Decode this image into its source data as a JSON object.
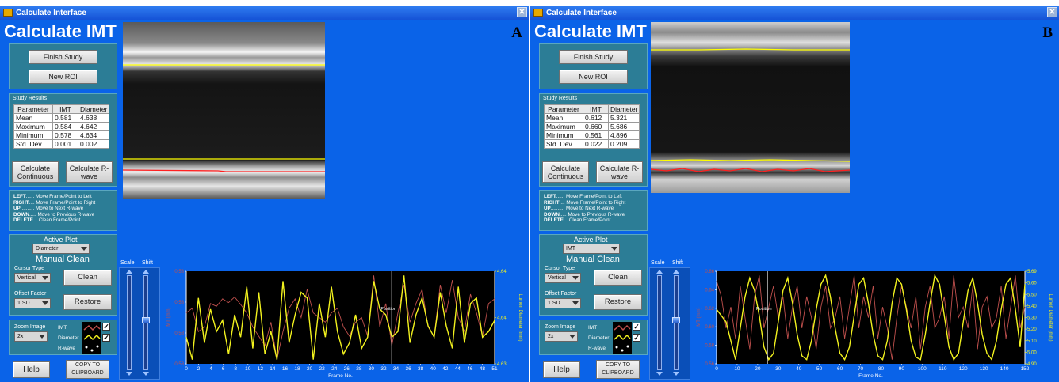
{
  "panels": [
    {
      "window_title": "Calculate Interface",
      "app_title": "Calculate IMT",
      "panel_letter": "A",
      "buttons": {
        "finish_study": "Finish Study",
        "new_roi": "New ROI",
        "calc_continuous": "Calculate Continuous",
        "calc_rwave": "Calculate R-wave",
        "clean": "Clean",
        "restore": "Restore",
        "help": "Help",
        "copy_clipboard": "COPY TO CLIPBOARD"
      },
      "study_results": {
        "label": "Study Results",
        "headers": [
          "Parameter",
          "IMT",
          "Diameter"
        ],
        "rows": [
          [
            "Mean",
            "0.581",
            "4.638"
          ],
          [
            "Maximum",
            "0.584",
            "4.642"
          ],
          [
            "Minimum",
            "0.578",
            "4.634"
          ],
          [
            "Std. Dev.",
            "0.001",
            "0.002"
          ]
        ]
      },
      "shortcuts": [
        {
          "key": "LEFT",
          "dots": "......",
          "desc": "Move Frame/Point to Left"
        },
        {
          "key": "RIGHT",
          "dots": "....",
          "desc": "Move Frame/Point to Right"
        },
        {
          "key": "UP",
          "dots": "..........",
          "desc": "Move to Next R-wave"
        },
        {
          "key": "DOWN",
          "dots": ".....",
          "desc": "Move to Previous R-wave"
        },
        {
          "key": "DELETE",
          "dots": "...",
          "desc": "Clean Frame/Point"
        }
      ],
      "active_plot": {
        "label": "Active Plot",
        "value": "Diameter"
      },
      "manual_clean": "Manual Clean",
      "cursor_type": {
        "label": "Cursor Type",
        "value": "Vertical"
      },
      "offset_factor": {
        "label": "Offset Factor",
        "value": "1 SD"
      },
      "zoom_image": {
        "label": "Zoom Image",
        "value": "2x"
      },
      "legend": {
        "imt": "IMT",
        "diameter": "Diameter",
        "rwave": "R-wave"
      },
      "scale_label": "Scale",
      "shift_label": "Shift",
      "chart_data": {
        "type": "line",
        "x_label": "Frame No.",
        "x_ticks": [
          "0",
          "2",
          "4",
          "6",
          "8",
          "10",
          "12",
          "14",
          "16",
          "18",
          "20",
          "22",
          "24",
          "26",
          "28",
          "30",
          "32",
          "34",
          "36",
          "38",
          "40",
          "42",
          "44",
          "46",
          "48",
          "51"
        ],
        "xlim": [
          0,
          51
        ],
        "y_left_label": "IMT (mm)",
        "y_left_ticks": [
          "0.58",
          "0.58",
          "0.58",
          "0.58"
        ],
        "y_right_label": "Lumen Diameter (mm)",
        "y_right_ticks": [
          "4.64",
          "4.64",
          "4.63"
        ],
        "cursor_label": "Position",
        "cursor_x": 34,
        "series": [
          {
            "name": "IMT",
            "color": "#c0504d",
            "values": [
              0.55,
              0.6,
              0.35,
              0.4,
              0.65,
              0.62,
              0.7,
              0.66,
              0.72,
              0.64,
              0.55,
              0.4,
              0.3,
              0.2,
              0.45,
              0.05,
              0.35,
              0.6,
              0.7,
              0.5,
              0.8,
              0.55,
              0.5,
              0.45,
              0.55,
              0.6,
              0.4,
              0.3,
              0.45,
              0.5,
              0.3,
              0.95,
              0.4,
              0.65,
              0.2,
              0.55,
              0.85,
              0.45,
              0.65,
              0.8,
              0.4,
              0.3,
              0.85,
              0.55,
              0.9,
              0.5,
              0.35,
              0.75,
              0.55,
              0.3,
              0.65,
              0.7
            ]
          },
          {
            "name": "Diameter",
            "color": "#f2f21e",
            "values": [
              0.35,
              0.15,
              0.7,
              0.3,
              0.6,
              0.4,
              0.5,
              0.2,
              0.55,
              0.35,
              0.8,
              0.25,
              0.75,
              0.2,
              0.4,
              0.15,
              0.85,
              0.3,
              0.55,
              0.75,
              0.7,
              0.15,
              0.65,
              0.35,
              0.8,
              0.4,
              0.2,
              0.3,
              0.55,
              0.25,
              0.35,
              0.85,
              0.6,
              0.55,
              0.35,
              0.4,
              0.9,
              0.3,
              0.55,
              0.7,
              0.45,
              0.35,
              0.75,
              0.45,
              0.25,
              0.8,
              0.3,
              0.65,
              0.7,
              0.35,
              0.4,
              0.5
            ]
          }
        ]
      }
    },
    {
      "window_title": "Calculate Interface",
      "app_title": "Calculate IMT",
      "panel_letter": "B",
      "buttons": {
        "finish_study": "Finish Study",
        "new_roi": "New ROI",
        "calc_continuous": "Calculate Continuous",
        "calc_rwave": "Calculate R-wave",
        "clean": "Clean",
        "restore": "Restore",
        "help": "Help",
        "copy_clipboard": "COPY TO CLIPBOARD"
      },
      "study_results": {
        "label": "Study Results",
        "headers": [
          "Parameter",
          "IMT",
          "Diameter"
        ],
        "rows": [
          [
            "Mean",
            "0.612",
            "5.321"
          ],
          [
            "Maximum",
            "0.660",
            "5.686"
          ],
          [
            "Minimum",
            "0.561",
            "4.896"
          ],
          [
            "Std. Dev.",
            "0.022",
            "0.209"
          ]
        ]
      },
      "shortcuts": [
        {
          "key": "LEFT",
          "dots": "......",
          "desc": "Move Frame/Point to Left"
        },
        {
          "key": "RIGHT",
          "dots": "....",
          "desc": "Move Frame/Point to Right"
        },
        {
          "key": "UP",
          "dots": "..........",
          "desc": "Move to Next R-wave"
        },
        {
          "key": "DOWN",
          "dots": ".....",
          "desc": "Move to Previous R-wave"
        },
        {
          "key": "DELETE",
          "dots": "...",
          "desc": "Clean Frame/Point"
        }
      ],
      "active_plot": {
        "label": "Active Plot",
        "value": "IMT"
      },
      "manual_clean": "Manual Clean",
      "cursor_type": {
        "label": "Cursor Type",
        "value": "Vertical"
      },
      "offset_factor": {
        "label": "Offset Factor",
        "value": "1 SD"
      },
      "zoom_image": {
        "label": "Zoom Image",
        "value": "2x"
      },
      "legend": {
        "imt": "IMT",
        "diameter": "Diameter",
        "rwave": "R-wave"
      },
      "scale_label": "Scale",
      "shift_label": "Shift",
      "chart_data": {
        "type": "line",
        "x_label": "Frame No.",
        "x_ticks": [
          "0",
          "10",
          "20",
          "30",
          "40",
          "50",
          "60",
          "70",
          "80",
          "90",
          "100",
          "110",
          "120",
          "130",
          "140",
          "152"
        ],
        "xlim": [
          0,
          152
        ],
        "y_left_label": "IMT (mm)",
        "y_left_ticks": [
          "0.66",
          "0.64",
          "0.62",
          "0.60",
          "0.58",
          "0.56"
        ],
        "y_right_label": "Lumen Diameter (mm)",
        "y_right_ticks": [
          "5.69",
          "5.60",
          "5.50",
          "5.40",
          "5.30",
          "5.20",
          "5.10",
          "5.00",
          "4.90"
        ],
        "cursor_label": "Position",
        "cursor_x": 25,
        "series": [
          {
            "name": "IMT",
            "color": "#c0504d",
            "values": [
              0.645,
              0.63,
              0.6,
              0.62,
              0.59,
              0.64,
              0.61,
              0.58,
              0.63,
              0.65,
              0.6,
              0.62,
              0.64,
              0.61,
              0.63,
              0.59,
              0.62,
              0.64,
              0.6,
              0.63,
              0.61,
              0.58,
              0.62,
              0.64,
              0.6,
              0.61,
              0.63,
              0.59,
              0.62,
              0.65,
              0.6,
              0.63,
              0.61,
              0.64,
              0.59,
              0.62,
              0.6,
              0.57,
              0.61,
              0.64,
              0.62,
              0.6,
              0.63,
              0.58,
              0.62,
              0.64,
              0.6,
              0.61,
              0.63,
              0.59,
              0.65,
              0.61,
              0.62,
              0.6,
              0.64,
              0.58,
              0.62,
              0.63,
              0.6,
              0.61,
              0.64,
              0.59,
              0.62,
              0.65,
              0.6,
              0.62
            ]
          },
          {
            "name": "Diameter",
            "color": "#f2f21e",
            "values": [
              5.35,
              5.3,
              5.25,
              5.1,
              4.95,
              5.2,
              5.45,
              5.6,
              5.5,
              5.3,
              5.05,
              4.95,
              5.0,
              5.25,
              5.5,
              5.6,
              5.4,
              5.15,
              4.98,
              4.95,
              5.1,
              5.35,
              5.55,
              5.62,
              5.45,
              5.2,
              5.0,
              4.95,
              5.05,
              5.3,
              5.55,
              5.6,
              5.4,
              5.15,
              4.98,
              4.95,
              5.1,
              5.4,
              5.6,
              5.55,
              5.35,
              5.1,
              4.97,
              4.95,
              5.15,
              5.4,
              5.62,
              5.55,
              5.3,
              5.05,
              4.95,
              5.0,
              5.25,
              5.5,
              5.6,
              5.4,
              5.15,
              5.0,
              4.95,
              5.1,
              5.35,
              5.55,
              5.6,
              5.35,
              5.05,
              5.55
            ]
          }
        ]
      }
    }
  ]
}
